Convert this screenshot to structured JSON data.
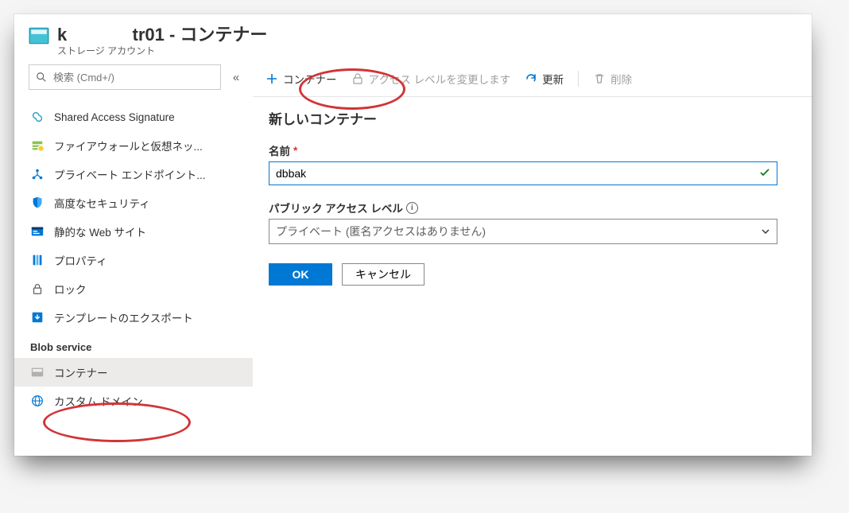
{
  "header": {
    "title_prefix": "k",
    "title_suffix": "tr01 - コンテナー",
    "subtitle": "ストレージ アカウント"
  },
  "search": {
    "placeholder": "検索 (Cmd+/)"
  },
  "sidebar": {
    "items": [
      {
        "icon": "sas",
        "label": "Shared Access Signature"
      },
      {
        "icon": "firewall",
        "label": "ファイアウォールと仮想ネッ..."
      },
      {
        "icon": "endpoint",
        "label": "プライベート エンドポイント..."
      },
      {
        "icon": "shield",
        "label": "高度なセキュリティ"
      },
      {
        "icon": "website",
        "label": "静的な Web サイト"
      },
      {
        "icon": "props",
        "label": "プロパティ"
      },
      {
        "icon": "lock",
        "label": "ロック"
      },
      {
        "icon": "template",
        "label": "テンプレートのエクスポート"
      }
    ],
    "section_label": "Blob service",
    "section_items": [
      {
        "icon": "container",
        "label": "コンテナー",
        "selected": true
      },
      {
        "icon": "domain",
        "label": "カスタム ドメイン"
      }
    ]
  },
  "toolbar": {
    "add_label": "コンテナー",
    "access_label": "アクセス レベルを変更します",
    "refresh_label": "更新",
    "delete_label": "削除"
  },
  "panel": {
    "heading": "新しいコンテナー",
    "name_label": "名前",
    "name_value": "dbbak",
    "access_label": "パブリック アクセス レベル",
    "access_value": "プライベート (匿名アクセスはありません)",
    "ok_label": "OK",
    "cancel_label": "キャンセル"
  },
  "colors": {
    "azure_blue": "#0078d4",
    "highlight_red": "#d13438",
    "ok_green": "#107c10"
  }
}
